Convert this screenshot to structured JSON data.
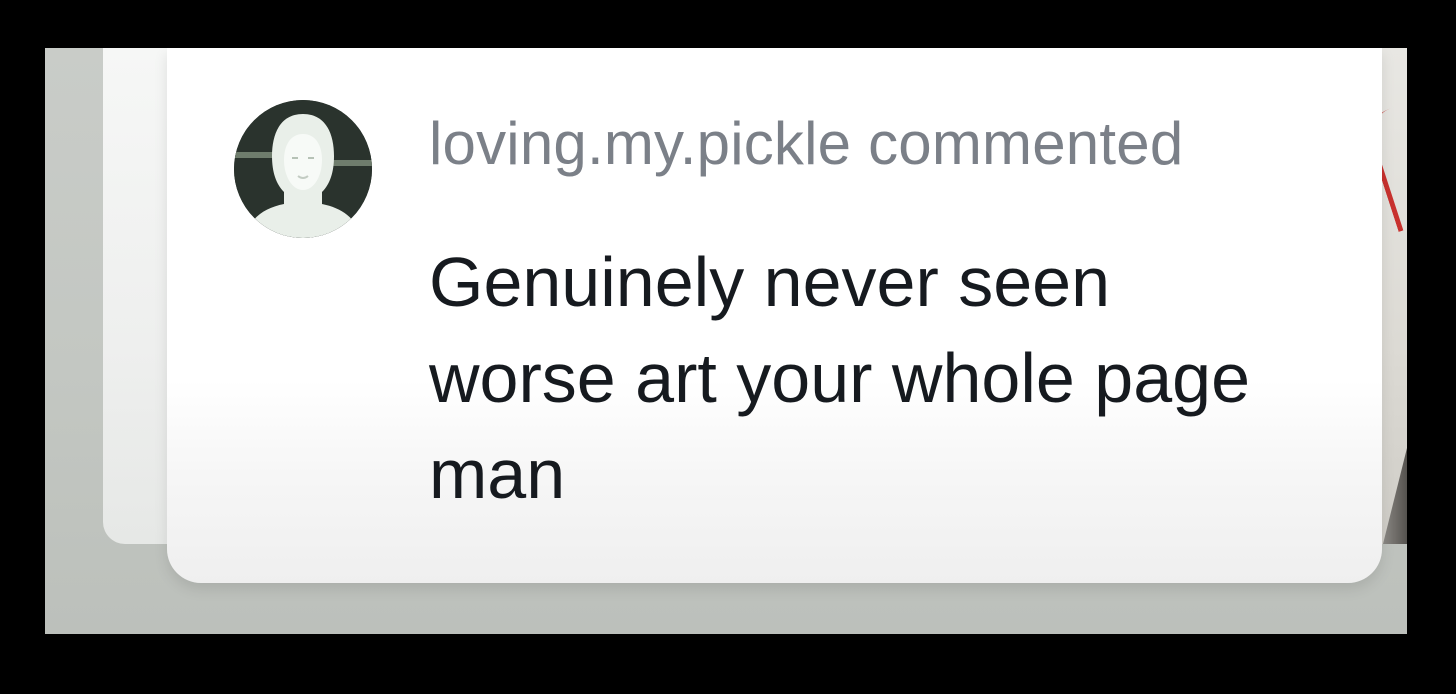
{
  "notification": {
    "username": "loving.my.pickle",
    "action": "commented",
    "comment_text": "Genuinely never seen worse art your whole page man",
    "avatar_icon": "user-avatar"
  },
  "colors": {
    "card_background": "#ffffff",
    "header_text": "#7b8088",
    "comment_text": "#161a1f",
    "backdrop": "#c4c7c3"
  }
}
